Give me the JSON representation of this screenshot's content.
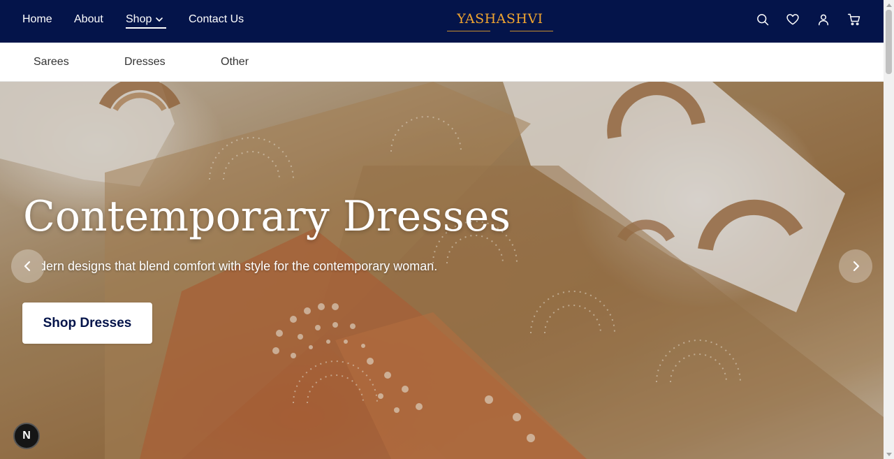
{
  "nav": {
    "home": "Home",
    "about": "About",
    "shop": "Shop",
    "contact": "Contact Us",
    "logo": "YASHASHVI"
  },
  "icons": {
    "search": "search-icon",
    "wishlist": "heart-icon",
    "account": "user-icon",
    "cart": "cart-icon"
  },
  "subnav": {
    "items": [
      "Sarees",
      "Dresses",
      "Other"
    ]
  },
  "hero": {
    "title": "Contemporary Dresses",
    "subtitle": "Modern designs that blend comfort with style for the contemporary woman.",
    "cta": "Shop Dresses",
    "prev": "chevron-left-icon",
    "next": "chevron-right-icon"
  },
  "badge": {
    "letter": "N"
  },
  "colors": {
    "nav_bg": "#04144a",
    "logo": "#f0a530",
    "button_text": "#04144a"
  }
}
